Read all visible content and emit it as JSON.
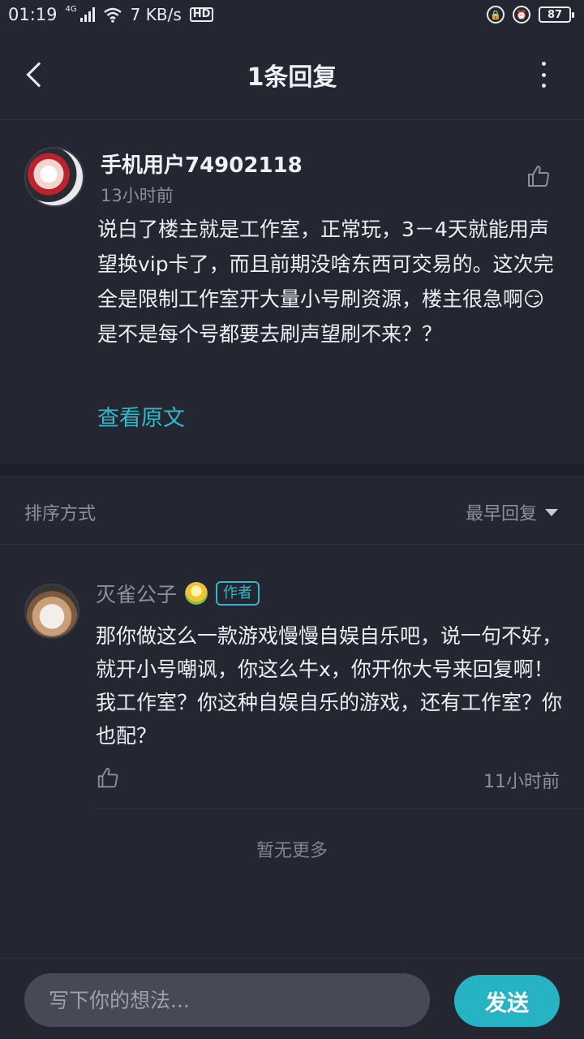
{
  "status_bar": {
    "time": "01:19",
    "network_type": "4G",
    "speed": "7 KB/s",
    "hd_label": "HD",
    "battery": "87"
  },
  "header": {
    "title": "1条回复"
  },
  "main_comment": {
    "author": "手机用户74902118",
    "time": "13小时前",
    "text": "说白了楼主就是工作室，正常玩，3－4天就能用声望换vip卡了，而且前期没啥东西可交易的。这次完全是限制工作室开大量小号刷资源，楼主很急啊😏 是不是每个号都要去刷声望刷不来？？",
    "view_original_label": "查看原文"
  },
  "sort": {
    "label": "排序方式",
    "selected": "最早回复"
  },
  "replies": [
    {
      "author": "灭雀公子",
      "badge": "作者",
      "text": "那你做这么一款游戏慢慢自娱自乐吧，说一句不好，就开小号嘲讽，你这么牛x，你开你大号来回复啊！我工作室？你这种自娱自乐的游戏，还有工作室？你也配？",
      "time": "11小时前"
    }
  ],
  "footer_note": "暂无更多",
  "composer": {
    "placeholder": "写下你的想法...",
    "send_label": "发送"
  },
  "colors": {
    "background": "#242731",
    "accent": "#31b9c9",
    "send_button": "#26b3c3"
  }
}
